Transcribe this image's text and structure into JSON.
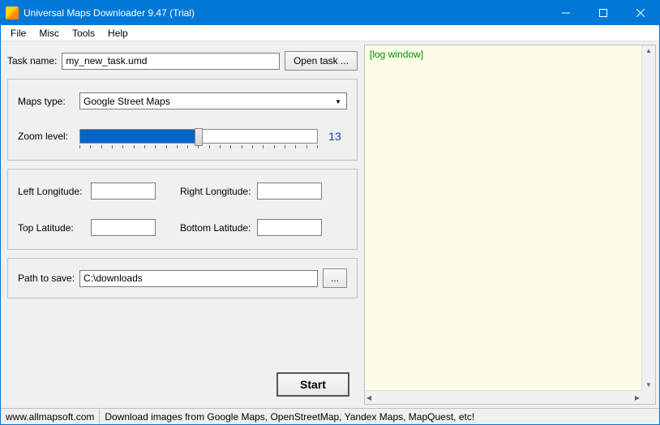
{
  "window": {
    "title": "Universal Maps Downloader 9.47 (Trial)"
  },
  "menu": {
    "file": "File",
    "misc": "Misc",
    "tools": "Tools",
    "help": "Help"
  },
  "task": {
    "label": "Task name:",
    "value": "my_new_task.umd",
    "open_btn": "Open task ..."
  },
  "maps": {
    "type_label": "Maps type:",
    "type_value": "Google Street Maps",
    "zoom_label": "Zoom level:",
    "zoom_value": "13"
  },
  "coords": {
    "left_lon_label": "Left Longitude:",
    "left_lon_value": "",
    "right_lon_label": "Right Longitude:",
    "right_lon_value": "",
    "top_lat_label": "Top Latitude:",
    "top_lat_value": "",
    "bottom_lat_label": "Bottom Latitude:",
    "bottom_lat_value": ""
  },
  "path": {
    "label": "Path to save:",
    "value": "C:\\downloads",
    "browse": "..."
  },
  "start_btn": "Start",
  "log": {
    "header": "[log window]"
  },
  "status": {
    "url": "www.allmapsoft.com",
    "msg": "Download images from Google Maps, OpenStreetMap, Yandex Maps, MapQuest, etc!"
  }
}
